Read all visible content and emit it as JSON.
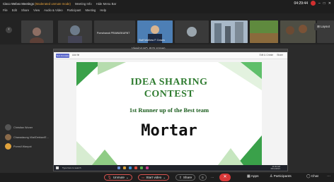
{
  "window": {
    "app_title": "Cisco Webex Meetings",
    "mode_text": "(Moderated unmute mode)",
    "meeting_info": "Meeting Info",
    "hide_menu": "Hide Menu Bar",
    "time": "04:29:44"
  },
  "menu": [
    "File",
    "Edit",
    "Share",
    "View",
    "Audio & Video",
    "Participant",
    "Meeting",
    "Help"
  ],
  "participants": [
    {
      "name": ""
    },
    {
      "name": ""
    },
    {
      "name": "Pornchanok PRAWASKARNT"
    },
    {
      "name": "Staff Matthew P. Downs"
    },
    {
      "name": ""
    },
    {
      "name": ""
    },
    {
      "name": ""
    },
    {
      "name": ""
    }
  ],
  "layout_label": "Layout",
  "share": {
    "banner": "Viewing HO_6U's screen",
    "sub": "Shared",
    "tb_button": "Text Annotate",
    "tb_label": "Add fle",
    "tb_right": [
      "Edit & Create",
      "Share"
    ],
    "slide": {
      "line1": "IDEA SHARING",
      "line2": "CONTEST",
      "line3": "1st Runner up of the Best team",
      "line4": "Mortar"
    },
    "taskbar_search": "Type here to search",
    "taskbar_time": "11:20 AM",
    "taskbar_date": "15/11/2021"
  },
  "side": [
    {
      "name": "Christian Woner"
    },
    {
      "name": "Chanadaung Vilai/Debian/E..."
    },
    {
      "name": "Pornsil Wanpot"
    }
  ],
  "controls": {
    "unmute": "Unmute",
    "start_video": "Start video",
    "share": "Share",
    "apps": "Apps",
    "participants": "Participants",
    "chat": "Chat"
  },
  "colors": {
    "accent_green": "#2e7b2f",
    "end_red": "#d93838"
  }
}
